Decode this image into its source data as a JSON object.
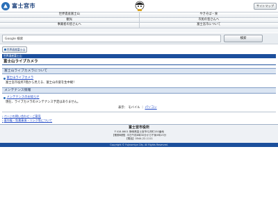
{
  "header": {
    "logo_text": "富士宮市",
    "sitemap_label": "サイトマップ"
  },
  "nav": {
    "row1": [
      "世界遺産富士山",
      "やきそば・食"
    ],
    "row2": [
      "観光",
      "市民の皆さんへ"
    ],
    "row3": [
      "事業者の皆さんへ",
      "富士宮市について"
    ]
  },
  "search": {
    "value": "Google 検索",
    "button_label": "検索"
  },
  "crumb_button": "世界遺産富士山",
  "category_bar": "世界遺産富士山",
  "page_title": "富士山ライブカメラ",
  "section1": {
    "heading": "富士山ライブカメラについて",
    "link": "富士山ライブカメラ",
    "text": "富士宮市役所7階から見える、富士山の姿を生中継！"
  },
  "section2": {
    "heading": "メンテナンス情報",
    "link": "メンテナンスのお知らせ",
    "text": "現在、ライブカメラのメンテナンス予定はありません。"
  },
  "display": {
    "prefix": "表示：",
    "mobile": "モバイル",
    "separator": "｜",
    "pc": "パソコン"
  },
  "footer_links": [
    "ページの問い合わせ・ご意見",
    "著作権・免責事項・リンク等について"
  ],
  "footer": {
    "org": "富士宮市役所",
    "address": "〒418-8601 静岡県富士宮市弓沢町150番地",
    "hours": "【業務時間】平日午前8時30分から午後5時15分",
    "tel": "【電話】0544-22-1111"
  },
  "copyright": "Copyright © Fujinomiya City. All Rights Reserved.",
  "colors": {
    "accent": "#1c4f9c",
    "link": "#1a44c4",
    "section_bg": "#dbe5f2"
  }
}
